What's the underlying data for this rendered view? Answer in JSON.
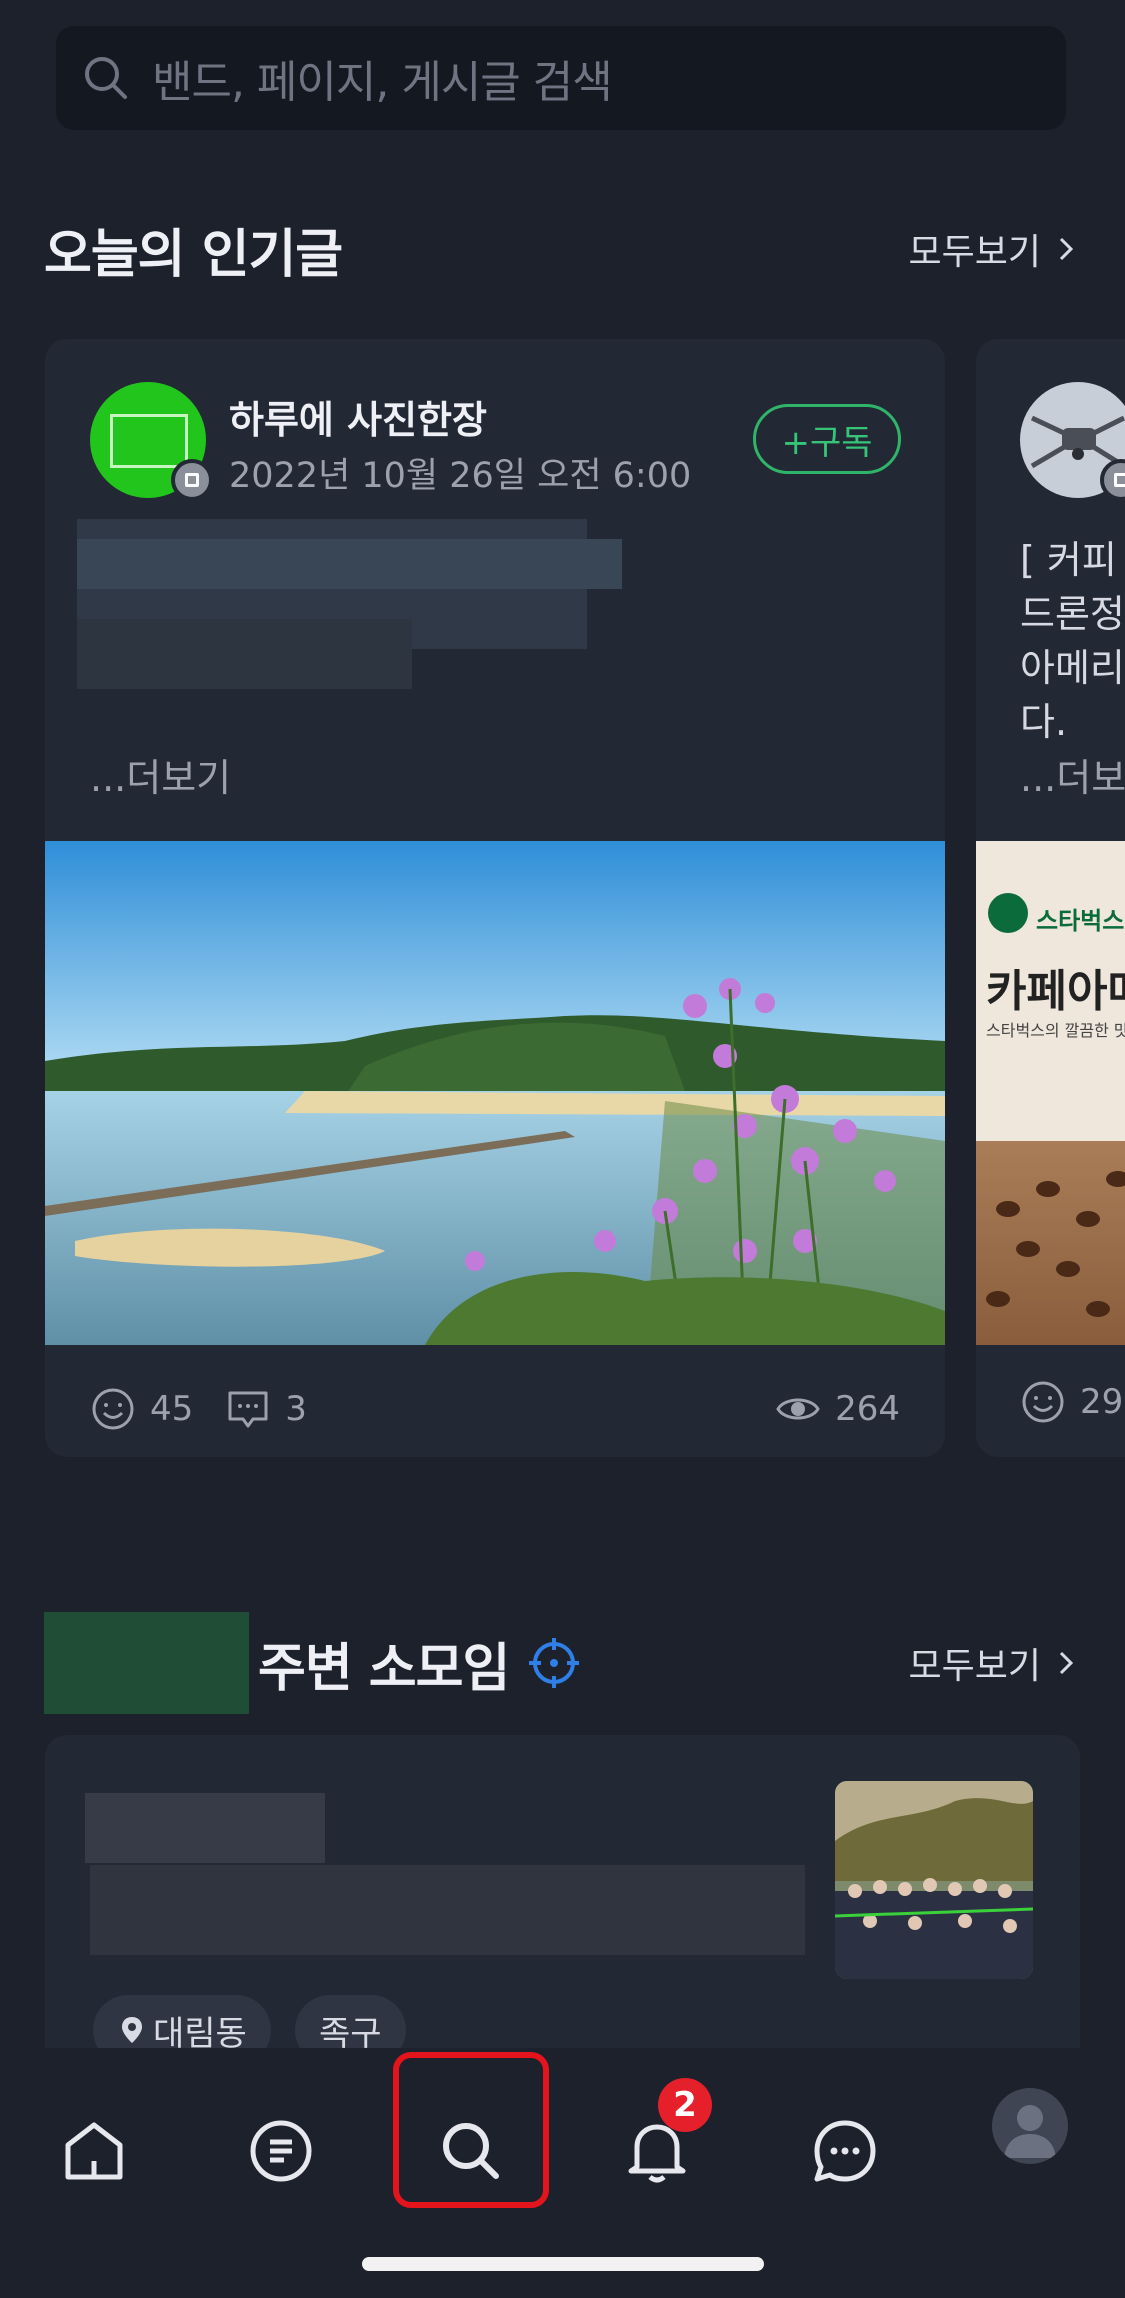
{
  "search": {
    "placeholder": "밴드, 페이지, 게시글 검색",
    "icon": "search-icon"
  },
  "popular": {
    "title": "오늘의 인기글",
    "see_all": "모두보기",
    "post": {
      "author": "하루에 사진한장",
      "date": "2022년 10월 26일 오전 6:00",
      "subscribe_label": "+구독",
      "more_label": "...더보기",
      "likes": "45",
      "comments": "3",
      "views": "264"
    },
    "peek_post": {
      "text_lines": [
        "[ 커피",
        "드론정",
        "아메리",
        "다."
      ],
      "more_label": "...더보",
      "ad_brand": "스타벅스",
      "ad_headline": "카페아메",
      "ad_tagline": "스타벅스의 깔끔한 맛을 ㅈ",
      "likes": "29"
    }
  },
  "nearby": {
    "title": "주변 소모임",
    "see_all": "모두보기",
    "chips": [
      {
        "label": "대림동",
        "icon": "location-pin-icon"
      },
      {
        "label": "족구"
      }
    ]
  },
  "tabbar": {
    "items": [
      "home-icon",
      "feed-icon",
      "search-icon",
      "bell-icon",
      "chat-icon",
      "profile-icon"
    ],
    "active": "search-icon",
    "notification_count": "2"
  },
  "colors": {
    "background": "#1d212c",
    "card": "#232835",
    "accent_green": "#35c478",
    "badge_red": "#e5202b",
    "highlight": "#e3141c"
  }
}
